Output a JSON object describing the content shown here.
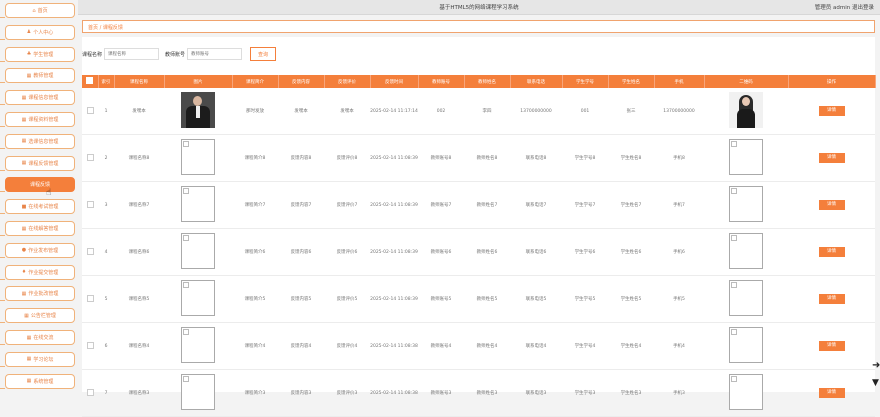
{
  "app": {
    "title": "基于HTML5的网络课程学习系统",
    "user_text": "管理员 admin  退出登录"
  },
  "sidebar": {
    "items": [
      {
        "icon": "⌂",
        "label": "首页"
      },
      {
        "icon": "♟",
        "label": "个人中心"
      },
      {
        "icon": "♣",
        "label": "学生管理"
      },
      {
        "icon": "▦",
        "label": "教师管理"
      },
      {
        "icon": "▦",
        "label": "课程信息管理"
      },
      {
        "icon": "▦",
        "label": "课程资料管理"
      },
      {
        "icon": "▦",
        "label": "选课信息管理"
      },
      {
        "icon": "▦",
        "label": "课程反馈管理"
      },
      {
        "icon": "",
        "label": "课程反馈",
        "active": true
      },
      {
        "icon": "■",
        "label": "在线考试管理"
      },
      {
        "icon": "▦",
        "label": "在线解答管理"
      },
      {
        "icon": "●",
        "label": "作业发布管理"
      },
      {
        "icon": "♦",
        "label": "作业提交管理"
      },
      {
        "icon": "▦",
        "label": "作业批改管理"
      },
      {
        "icon": "▦",
        "label": "公告栏管理"
      },
      {
        "icon": "▦",
        "label": "在线交流"
      },
      {
        "icon": "▦",
        "label": "学习论坛"
      },
      {
        "icon": "▦",
        "label": "系统管理"
      }
    ]
  },
  "breadcrumb": {
    "text": "首页 / 课程反馈"
  },
  "search": {
    "course_label": "课程名称",
    "course_placeholder": "课程名称",
    "teacher_label": "教师账号",
    "teacher_placeholder": "教师账号",
    "button": "查询"
  },
  "table": {
    "headers": [
      "",
      "索引",
      "课程名称",
      "图片",
      "课程简介",
      "反馈内容",
      "反馈评价",
      "反馈时间",
      "教师账号",
      "教师姓名",
      "联系电话",
      "学生学号",
      "学生姓名",
      "手机",
      "二维码",
      "操作"
    ],
    "detail_label": "详情",
    "rows": [
      {
        "index": "1",
        "course": "发嘿本",
        "intro": "那时发放",
        "content": "发嘿本",
        "review": "发嘿本",
        "time": "2025-02-14 11:17:14",
        "tno": "002",
        "tname": "李四",
        "phone": "13700000000",
        "sno": "001",
        "sname": "张三",
        "mobile": "13700000000",
        "photo": "man",
        "qr": "woman"
      },
      {
        "index": "2",
        "course": "课程名称8",
        "intro": "课程简介8",
        "content": "反馈内容8",
        "review": "反馈评价8",
        "time": "2025-02-14 11:08:39",
        "tno": "教师账号8",
        "tname": "教师姓名8",
        "phone": "联系电话8",
        "sno": "学生学号8",
        "sname": "学生姓名8",
        "mobile": "手机8",
        "photo": "ph",
        "qr": "ph"
      },
      {
        "index": "3",
        "course": "课程名称7",
        "intro": "课程简介7",
        "content": "反馈内容7",
        "review": "反馈评价7",
        "time": "2025-02-14 11:08:39",
        "tno": "教师账号7",
        "tname": "教师姓名7",
        "phone": "联系电话7",
        "sno": "学生学号7",
        "sname": "学生姓名7",
        "mobile": "手机7",
        "photo": "ph",
        "qr": "ph"
      },
      {
        "index": "4",
        "course": "课程名称6",
        "intro": "课程简介6",
        "content": "反馈内容6",
        "review": "反馈评价6",
        "time": "2025-02-14 11:08:39",
        "tno": "教师账号6",
        "tname": "教师姓名6",
        "phone": "联系电话6",
        "sno": "学生学号6",
        "sname": "学生姓名6",
        "mobile": "手机6",
        "photo": "ph",
        "qr": "ph"
      },
      {
        "index": "5",
        "course": "课程名称5",
        "intro": "课程简介5",
        "content": "反馈内容5",
        "review": "反馈评价5",
        "time": "2025-02-14 11:08:39",
        "tno": "教师账号5",
        "tname": "教师姓名5",
        "phone": "联系电话5",
        "sno": "学生学号5",
        "sname": "学生姓名5",
        "mobile": "手机5",
        "photo": "ph",
        "qr": "ph"
      },
      {
        "index": "6",
        "course": "课程名称4",
        "intro": "课程简介4",
        "content": "反馈内容4",
        "review": "反馈评价4",
        "time": "2025-02-14 11:08:38",
        "tno": "教师账号4",
        "tname": "教师姓名4",
        "phone": "联系电话4",
        "sno": "学生学号4",
        "sname": "学生姓名4",
        "mobile": "手机4",
        "photo": "ph",
        "qr": "ph"
      },
      {
        "index": "7",
        "course": "课程名称3",
        "intro": "课程简介3",
        "content": "反馈内容3",
        "review": "反馈评价3",
        "time": "2025-02-14 11:08:38",
        "tno": "教师账号3",
        "tname": "教师姓名3",
        "phone": "联系电话3",
        "sno": "学生学号3",
        "sname": "学生姓名3",
        "mobile": "手机3",
        "photo": "ph",
        "qr": "ph"
      }
    ]
  },
  "colors": {
    "accent": "#f47f3b",
    "border": "#f0b27a"
  }
}
